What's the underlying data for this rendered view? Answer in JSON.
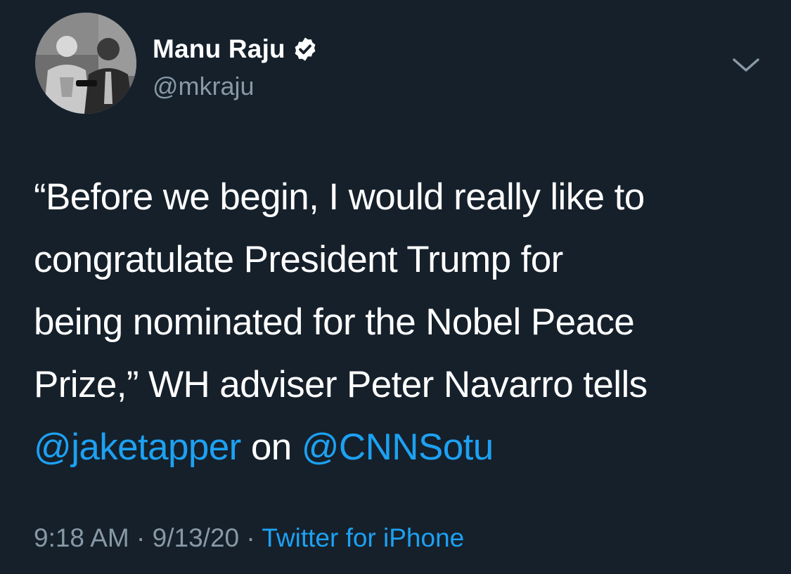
{
  "user": {
    "display_name": "Manu Raju",
    "handle": "@mkraju",
    "verified": true,
    "avatar": "profile-photo"
  },
  "tweet": {
    "text_lines": [
      "“Before we begin, I would really like to",
      "congratulate President Trump for",
      "being nominated for the Nobel Peace",
      "Prize,” WH adviser Peter Navarro tells"
    ],
    "mention_1": "@jaketapper",
    "connector": " on ",
    "mention_2": "@CNNSotu"
  },
  "meta": {
    "time": "9:18 AM",
    "separator": " · ",
    "date": "9/13/20",
    "source": "Twitter for iPhone"
  },
  "icons": {
    "verified": "verified-badge-icon",
    "menu": "chevron-down-icon"
  },
  "colors": {
    "background": "#15202b",
    "text": "#ffffff",
    "secondary": "#8899a6",
    "accent": "#1da1f2"
  }
}
